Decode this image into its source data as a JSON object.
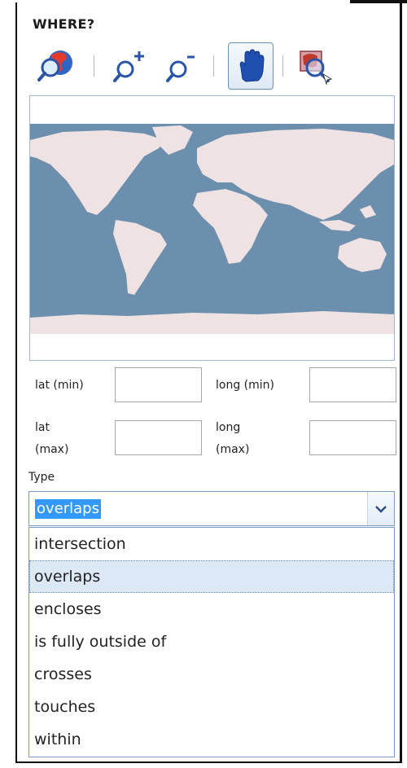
{
  "section": {
    "heading": "WHERE?"
  },
  "toolbar": {
    "tools": [
      {
        "name": "globe-search-icon"
      },
      {
        "name": "zoom-in-icon"
      },
      {
        "name": "zoom-out-icon"
      },
      {
        "name": "pan-hand-icon",
        "active": true
      },
      {
        "name": "select-area-icon"
      }
    ]
  },
  "map": {
    "land_color": "#efe2e2",
    "water_color": "#6d8fae"
  },
  "bbox": {
    "lat_min_label": "lat (min)",
    "long_min_label": "long (min)",
    "lat_max_label_1": "lat",
    "lat_max_label_2": "(max)",
    "long_max_label_1": "long",
    "long_max_label_2": "(max)",
    "lat_min_value": "",
    "long_min_value": "",
    "lat_max_value": "",
    "long_max_value": ""
  },
  "type": {
    "label": "Type",
    "selected": "overlaps",
    "options": [
      "intersection",
      "overlaps",
      "encloses",
      "is fully outside of",
      "crosses",
      "touches",
      "within"
    ]
  },
  "colors": {
    "accent": "#3399ff",
    "border": "#7a9cc4",
    "selected_bg": "#dde8f6"
  }
}
